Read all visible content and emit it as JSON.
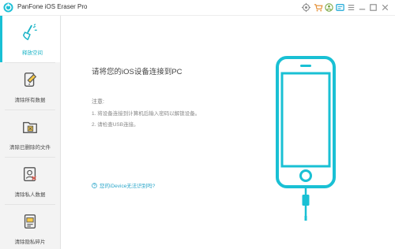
{
  "window": {
    "title": "PanFone iOS Eraser Pro",
    "controls": [
      "settings-icon",
      "cart-icon",
      "register-icon",
      "feedback-icon",
      "menu-icon",
      "minimize-icon",
      "maximize-icon",
      "close-icon"
    ]
  },
  "sidebar": {
    "items": [
      {
        "label": "释放空间",
        "icon": "broom-icon",
        "active": true
      },
      {
        "label": "清除所有数据",
        "icon": "phone-erase-icon",
        "active": false
      },
      {
        "label": "清除已删除的文件",
        "icon": "deleted-files-icon",
        "active": false
      },
      {
        "label": "清除私人数据",
        "icon": "private-data-icon",
        "active": false
      },
      {
        "label": "清除隐私碎片",
        "icon": "privacy-fragments-icon",
        "active": false
      }
    ]
  },
  "main": {
    "headline": "请将您的iOS设备连接到PC",
    "notes_title": "注意:",
    "notes": [
      "1. 将设备连接到计算机后输入密码以解锁设备。",
      "2. 请检查USB连接。"
    ],
    "help_link": "您的iDevice无法识别吗?"
  },
  "colors": {
    "accent": "#19c0d4",
    "sidebar_bg": "#f3f3f3",
    "link": "#2aa6c9"
  }
}
